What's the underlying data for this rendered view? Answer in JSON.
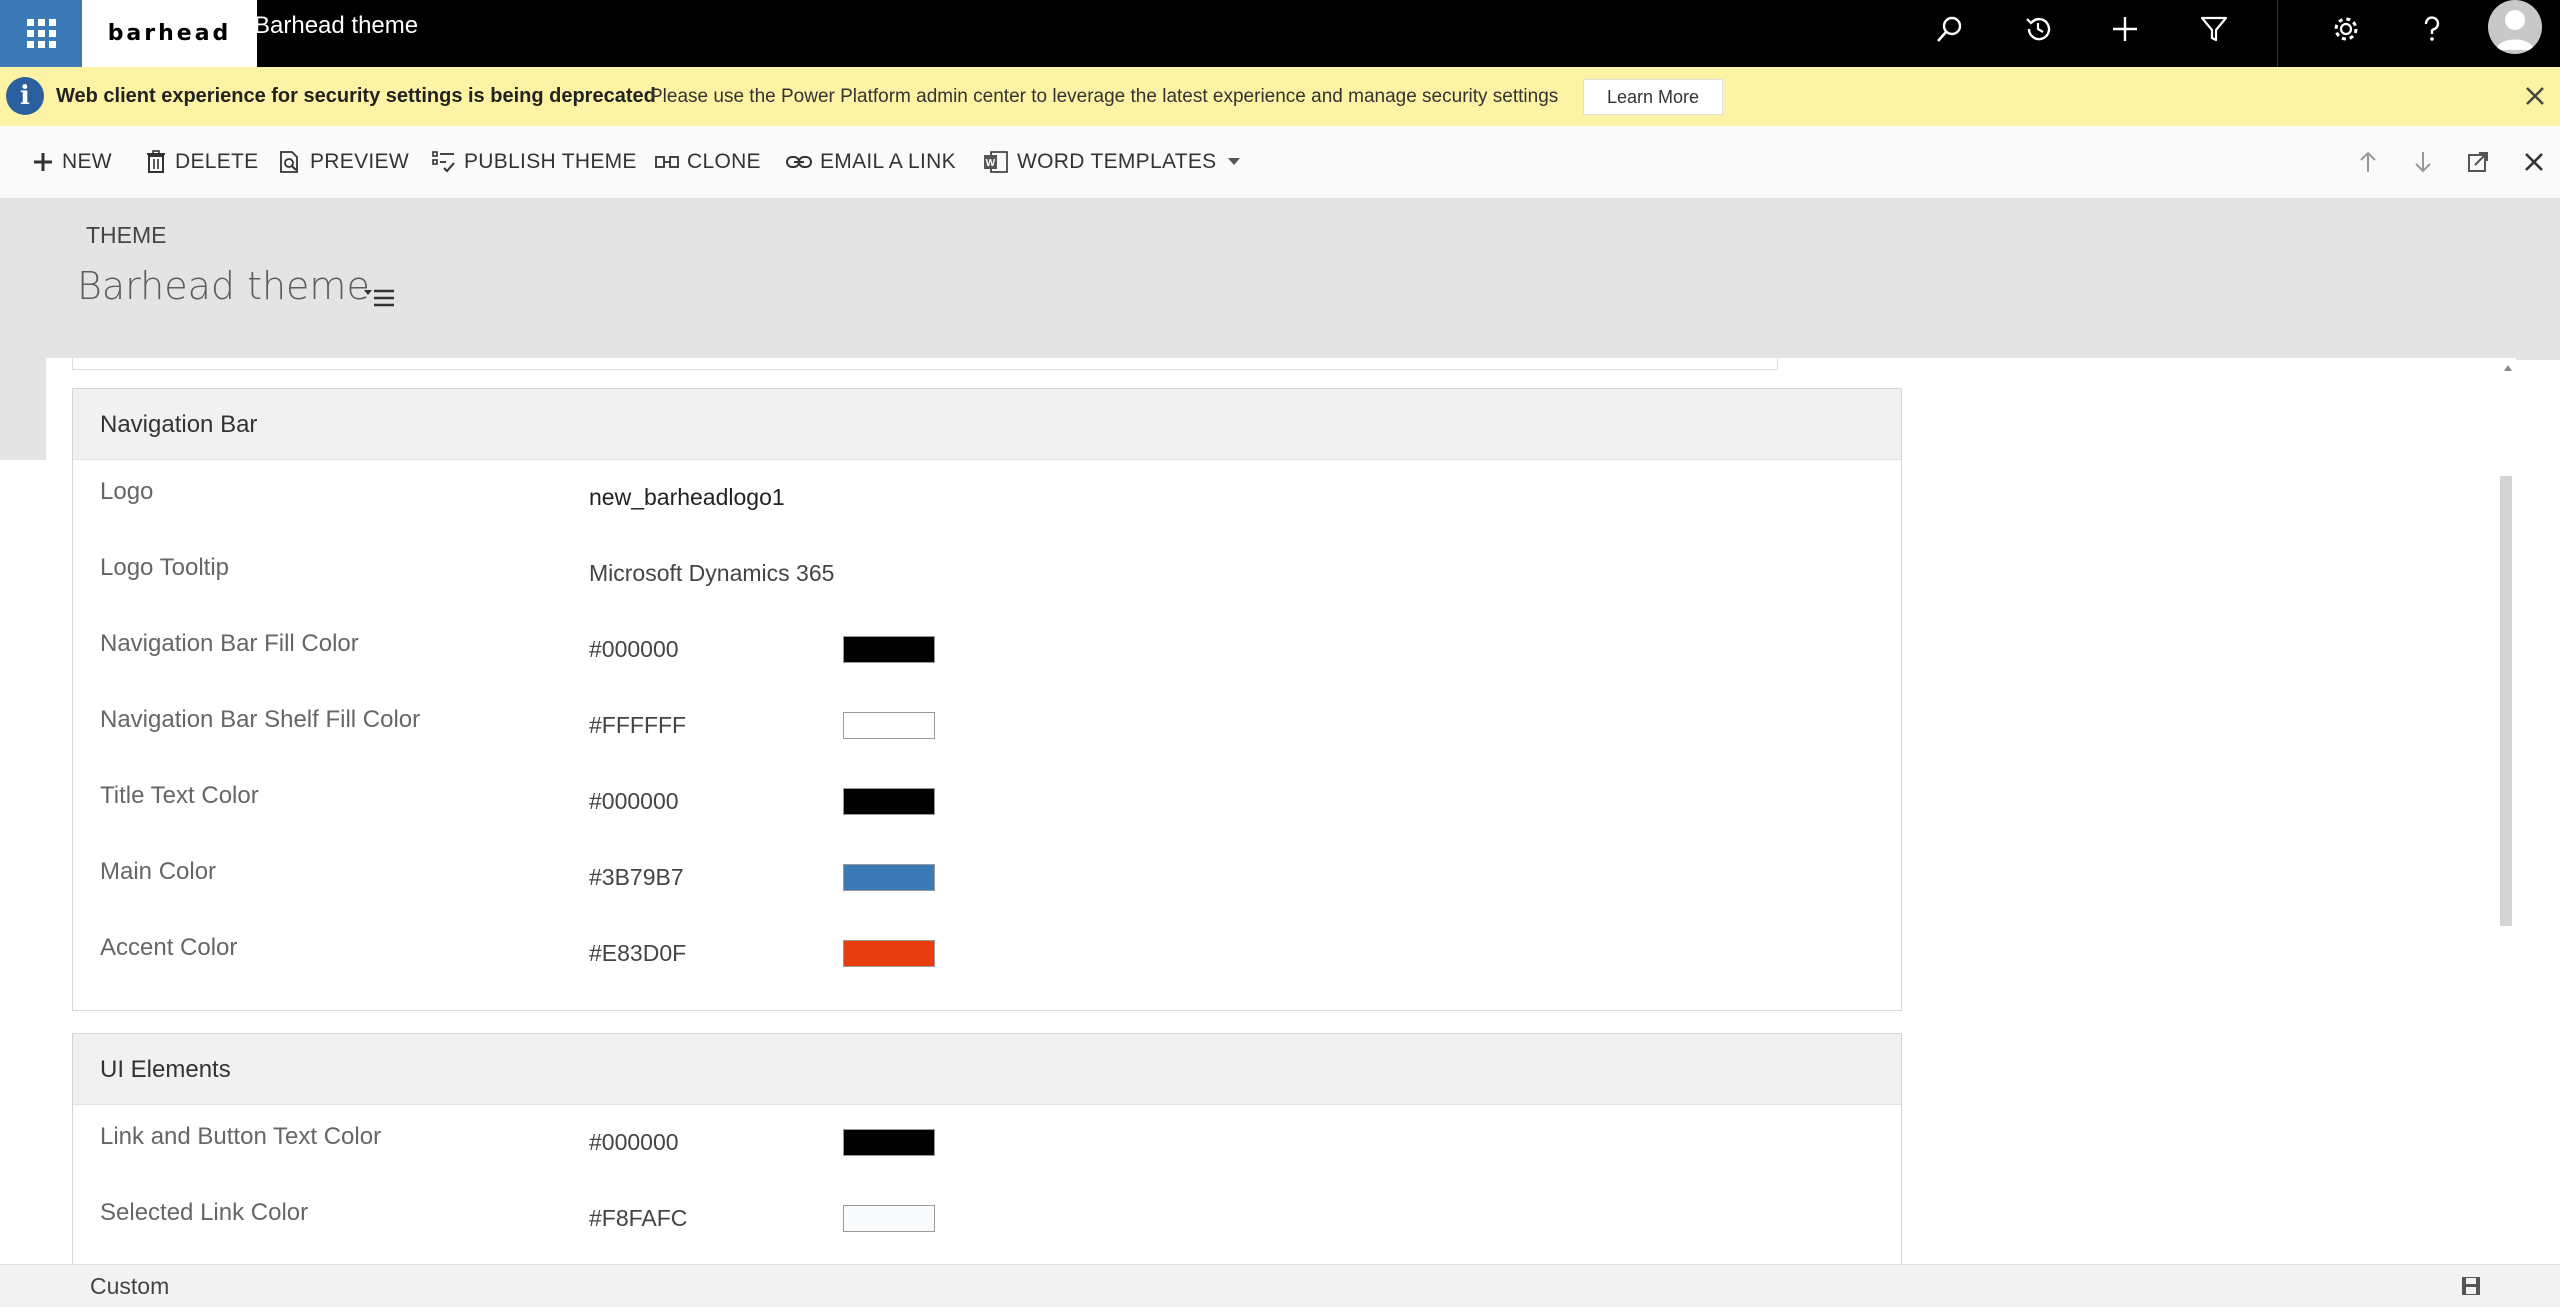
{
  "topbar": {
    "logo_text": "barhead",
    "app_title": "Barhead theme",
    "icons": [
      "waffle-icon",
      "search-icon",
      "history-icon",
      "plus-icon",
      "filter-icon",
      "gear-icon",
      "help-icon",
      "avatar"
    ]
  },
  "notice": {
    "title": "Web client experience for security settings is being deprecated",
    "message": "Please use the Power Platform admin center to leverage the latest experience and manage security settings",
    "learn_more": "Learn More"
  },
  "commands": {
    "new": "NEW",
    "delete": "DELETE",
    "preview": "PREVIEW",
    "publish": "PUBLISH THEME",
    "clone": "CLONE",
    "email": "EMAIL A LINK",
    "word_templates": "WORD TEMPLATES"
  },
  "entity": {
    "type": "THEME",
    "name": "Barhead theme"
  },
  "navigation_bar": {
    "heading": "Navigation Bar",
    "rows": [
      {
        "label": "Logo",
        "value": "new_barheadlogo1"
      },
      {
        "label": "Logo Tooltip",
        "value": "Microsoft Dynamics 365"
      },
      {
        "label": "Navigation Bar Fill Color",
        "value": "#000000",
        "swatch": "#000000"
      },
      {
        "label": "Navigation Bar Shelf Fill Color",
        "value": "#FFFFFF",
        "swatch": "#FFFFFF"
      },
      {
        "label": "Title Text Color",
        "value": "#000000",
        "swatch": "#000000"
      },
      {
        "label": "Main Color",
        "value": "#3B79B7",
        "swatch": "#3B79B7"
      },
      {
        "label": "Accent Color",
        "value": "#E83D0F",
        "swatch": "#E83D0F"
      }
    ]
  },
  "ui_elements": {
    "heading": "UI Elements",
    "rows": [
      {
        "label": "Link and Button Text Color",
        "value": "#000000",
        "swatch": "#000000"
      },
      {
        "label": "Selected Link Color",
        "value": "#F8FAFC",
        "swatch": "#F8FAFC"
      }
    ]
  },
  "footer": {
    "status": "Custom"
  },
  "colors": {
    "brand_blue": "#3b79b7",
    "notice_yellow": "#fcf3a4",
    "header_gray": "#e4e4e4"
  }
}
